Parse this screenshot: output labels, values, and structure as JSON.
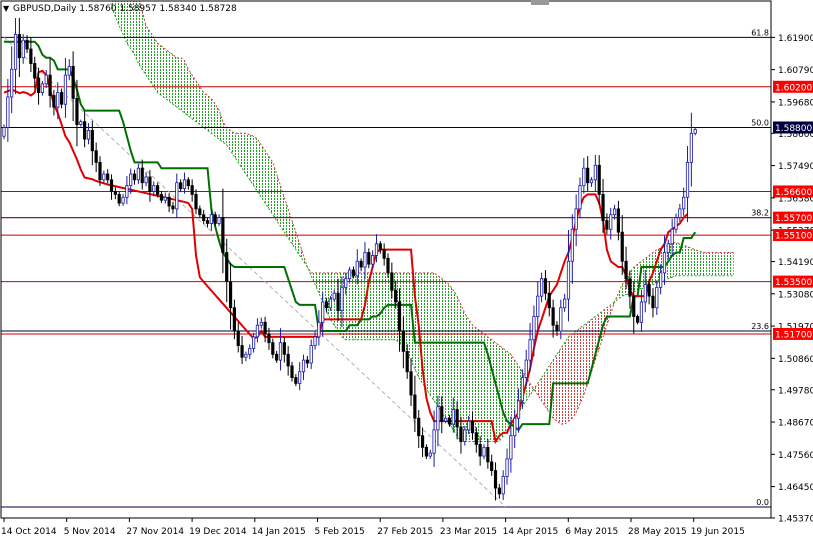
{
  "header": {
    "arrow": "▼",
    "symbol_line": "GBPUSD,Daily  1.58760 1.58957 1.58340 1.58728"
  },
  "colors": {
    "background": "#ffffff",
    "frame": "#000000",
    "bull": "#1a1aa8",
    "bear": "#000000",
    "tenkan": "#e00000",
    "kijun": "#007000",
    "cloud_bear": "#d04040",
    "cloud_bull": "#20a020",
    "level_red": "#cc0000",
    "level_navy": "#000040",
    "label_red_bg": "#ff0000",
    "label_navy_bg": "#000040",
    "label_text": "#ffffff"
  },
  "chart_data": {
    "type": "candlestick",
    "ylim": [
      1.4537,
      1.6315
    ],
    "y_ticks": [
      1.619,
      1.6079,
      1.5968,
      1.586,
      1.5749,
      1.5638,
      1.5527,
      1.5419,
      1.5308,
      1.5197,
      1.5086,
      1.4978,
      1.4867,
      1.4756,
      1.4645,
      1.4537
    ],
    "y_tick_labels": [
      "1.61900",
      "1.60790",
      "1.59680",
      "1.58600",
      "1.57490",
      "1.56380",
      "1.55270",
      "1.54190",
      "1.53080",
      "1.51970",
      "1.50860",
      "1.49780",
      "1.48670",
      "1.47560",
      "1.46450",
      "1.45370"
    ],
    "x_labels": [
      "14 Oct 2014",
      "5 Nov 2014",
      "27 Nov 2014",
      "19 Dec 2014",
      "14 Jan 2015",
      "5 Feb 2015",
      "27 Feb 2015",
      "23 Mar 2015",
      "14 Apr 2015",
      "6 May 2015",
      "28 May 2015",
      "19 Jun 2015"
    ],
    "levels": [
      {
        "value": 1.602,
        "label": "1.60200",
        "kind": "red"
      },
      {
        "value": 1.588,
        "label": "1.58800",
        "kind": "navy"
      },
      {
        "value": 1.566,
        "label": "1.56600",
        "kind": "red"
      },
      {
        "value": 1.557,
        "label": "1.55700",
        "kind": "red"
      },
      {
        "value": 1.551,
        "label": "1.55100",
        "kind": "red"
      },
      {
        "value": 1.535,
        "label": "1.53500",
        "kind": "red"
      },
      {
        "value": 1.517,
        "label": "1.51700",
        "kind": "red"
      }
    ],
    "fib_levels": [
      {
        "value": 1.619,
        "label": "61.8"
      },
      {
        "value": 1.588,
        "label": "50.0"
      },
      {
        "value": 1.557,
        "label": "38.2"
      },
      {
        "value": 1.518,
        "label": "23.6"
      },
      {
        "value": 1.4575,
        "label": "0.0"
      }
    ],
    "trendline": {
      "from": [
        "14 Oct 2014",
        1.619
      ],
      "to": [
        "14 Apr 2015",
        1.4575
      ]
    },
    "series": {
      "close": [
        1.588,
        1.5985,
        1.608,
        1.62,
        1.612,
        1.618,
        1.615,
        1.61,
        1.605,
        1.6,
        1.603,
        1.606,
        1.599,
        1.595,
        1.6,
        1.596,
        1.606,
        1.609,
        1.598,
        1.589,
        1.59,
        1.584,
        1.587,
        1.58,
        1.576,
        1.57,
        1.572,
        1.57,
        1.566,
        1.565,
        1.562,
        1.564,
        1.568,
        1.572,
        1.57,
        1.574,
        1.569,
        1.571,
        1.566,
        1.568,
        1.565,
        1.563,
        1.564,
        1.561,
        1.56,
        1.569,
        1.567,
        1.57,
        1.568,
        1.565,
        1.56,
        1.558,
        1.556,
        1.555,
        1.558,
        1.555,
        1.557,
        1.545,
        1.535,
        1.526,
        1.518,
        1.513,
        1.509,
        1.51,
        1.512,
        1.516,
        1.52,
        1.521,
        1.517,
        1.514,
        1.51,
        1.508,
        1.514,
        1.51,
        1.506,
        1.502,
        1.5,
        1.504,
        1.508,
        1.507,
        1.513,
        1.516,
        1.521,
        1.528,
        1.526,
        1.529,
        1.531,
        1.525,
        1.533,
        1.536,
        1.539,
        1.537,
        1.542,
        1.54,
        1.545,
        1.541,
        1.544,
        1.548,
        1.546,
        1.543,
        1.538,
        1.532,
        1.528,
        1.518,
        1.511,
        1.504,
        1.496,
        1.488,
        1.482,
        1.478,
        1.475,
        1.476,
        1.484,
        1.492,
        1.487,
        1.488,
        1.486,
        1.491,
        1.485,
        1.48,
        1.484,
        1.487,
        1.483,
        1.479,
        1.475,
        1.478,
        1.473,
        1.47,
        1.464,
        1.462,
        1.468,
        1.474,
        1.482,
        1.488,
        1.494,
        1.502,
        1.508,
        1.515,
        1.523,
        1.53,
        1.536,
        1.531,
        1.526,
        1.52,
        1.518,
        1.526,
        1.529,
        1.542,
        1.553,
        1.56,
        1.568,
        1.574,
        1.569,
        1.57,
        1.575,
        1.565,
        1.556,
        1.553,
        1.558,
        1.56,
        1.552,
        1.542,
        1.536,
        1.53,
        1.523,
        1.521,
        1.528,
        1.534,
        1.53,
        1.526,
        1.533,
        1.538,
        1.545,
        1.548,
        1.553,
        1.557,
        1.56,
        1.564,
        1.576,
        1.586,
        1.5873
      ],
      "tenkan": [
        1.6,
        1.6005,
        1.601,
        1.6005,
        1.5998,
        1.6002,
        1.5998,
        1.599,
        1.6,
        1.607,
        1.6075,
        1.606,
        1.601,
        1.596,
        1.593,
        1.589,
        1.585,
        1.583,
        1.58,
        1.577,
        1.5735,
        1.5708,
        1.5705,
        1.5702,
        1.5696,
        1.5692,
        1.5688,
        1.5684,
        1.5681,
        1.5678,
        1.5675,
        1.5672,
        1.5669,
        1.5666,
        1.5663,
        1.566,
        1.5657,
        1.5654,
        1.5651,
        1.5648,
        1.5645,
        1.5642,
        1.5639,
        1.5636,
        1.5633,
        1.563,
        1.5627,
        1.5624,
        1.562,
        1.56,
        1.544,
        1.5365,
        1.5349,
        1.5334,
        1.5319,
        1.5304,
        1.5289,
        1.5274,
        1.5259,
        1.5244,
        1.5229,
        1.5214,
        1.5199,
        1.5184,
        1.5169,
        1.5154,
        1.516,
        1.518,
        1.516,
        1.516,
        1.516,
        1.516,
        1.516,
        1.516,
        1.516,
        1.516,
        1.516,
        1.516,
        1.516,
        1.516,
        1.516,
        1.516,
        1.516,
        1.522,
        1.522,
        1.522,
        1.522,
        1.522,
        1.522,
        1.522,
        1.522,
        1.522,
        1.522,
        1.522,
        1.527,
        1.535,
        1.54,
        1.545,
        1.546,
        1.546,
        1.546,
        1.546,
        1.546,
        1.546,
        1.546,
        1.546,
        1.546,
        1.53,
        1.52,
        1.505,
        1.495,
        1.49,
        1.487,
        1.487,
        1.487,
        1.487,
        1.487,
        1.487,
        1.487,
        1.487,
        1.487,
        1.487,
        1.487,
        1.487,
        1.487,
        1.487,
        1.487,
        1.487,
        1.48,
        1.482,
        1.483,
        1.483,
        1.486,
        1.488,
        1.49,
        1.495,
        1.5,
        1.505,
        1.512,
        1.518,
        1.522,
        1.526,
        1.53,
        1.532,
        1.534,
        1.538,
        1.542,
        1.545,
        1.55,
        1.556,
        1.561,
        1.564,
        1.565,
        1.565,
        1.565,
        1.562,
        1.556,
        1.546,
        1.542,
        1.541,
        1.54,
        1.54,
        1.537,
        1.532,
        1.53,
        1.53,
        1.53,
        1.53,
        1.535,
        1.538,
        1.542,
        1.546,
        1.548,
        1.552,
        1.553,
        1.554,
        1.555,
        1.557,
        1.5582
      ],
      "kijun": [
        1.6175,
        1.6175,
        1.6175,
        1.6175,
        1.6175,
        1.6175,
        1.6175,
        1.6175,
        1.6175,
        1.616,
        1.613,
        1.612,
        1.612,
        1.611,
        1.608,
        1.608,
        1.608,
        1.608,
        1.605,
        1.601,
        1.596,
        1.5938,
        1.5938,
        1.5938,
        1.5938,
        1.5938,
        1.5938,
        1.5938,
        1.5938,
        1.5938,
        1.5938,
        1.59,
        1.585,
        1.58,
        1.576,
        1.576,
        1.576,
        1.576,
        1.576,
        1.576,
        1.576,
        1.574,
        1.574,
        1.574,
        1.574,
        1.574,
        1.574,
        1.574,
        1.574,
        1.574,
        1.574,
        1.574,
        1.574,
        1.574,
        1.56,
        1.554,
        1.549,
        1.545,
        1.543,
        1.541,
        1.54,
        1.54,
        1.54,
        1.54,
        1.54,
        1.54,
        1.54,
        1.54,
        1.54,
        1.54,
        1.54,
        1.54,
        1.54,
        1.54,
        1.536,
        1.532,
        1.528,
        1.527,
        1.527,
        1.527,
        1.527,
        1.527,
        1.518,
        1.518,
        1.518,
        1.518,
        1.518,
        1.518,
        1.518,
        1.518,
        1.52,
        1.52,
        1.52,
        1.522,
        1.522,
        1.522,
        1.523,
        1.523,
        1.524,
        1.526,
        1.527,
        1.527,
        1.527,
        1.527,
        1.527,
        1.527,
        1.527,
        1.514,
        1.514,
        1.514,
        1.514,
        1.514,
        1.514,
        1.514,
        1.514,
        1.514,
        1.514,
        1.514,
        1.514,
        1.514,
        1.514,
        1.514,
        1.514,
        1.514,
        1.514,
        1.514,
        1.51,
        1.505,
        1.5,
        1.495,
        1.49,
        1.487,
        1.486,
        1.485,
        1.484,
        1.486,
        1.486,
        1.486,
        1.486,
        1.486,
        1.486,
        1.486,
        1.486,
        1.5,
        1.5,
        1.5,
        1.5,
        1.5,
        1.5,
        1.5,
        1.5,
        1.5,
        1.5,
        1.505,
        1.51,
        1.515,
        1.52,
        1.523,
        1.523,
        1.523,
        1.523,
        1.523,
        1.523,
        1.523,
        1.53,
        1.53,
        1.54,
        1.54,
        1.54,
        1.54,
        1.54,
        1.54,
        1.54,
        1.542,
        1.544,
        1.545,
        1.545,
        1.55,
        1.55,
        1.55,
        1.552
      ],
      "senkou_a": [
        1.68,
        1.675,
        1.67,
        1.665,
        1.66,
        1.655,
        1.65,
        1.645,
        1.64,
        1.634,
        1.628,
        1.623,
        1.621,
        1.619,
        1.617,
        1.616,
        1.615,
        1.614,
        1.613,
        1.612,
        1.612,
        1.611,
        1.608,
        1.606,
        1.604,
        1.602,
        1.6,
        1.599,
        1.598,
        1.596,
        1.594,
        1.59,
        1.588,
        1.587,
        1.586,
        1.586,
        1.586,
        1.586,
        1.5855,
        1.585,
        1.584,
        1.582,
        1.58,
        1.578,
        1.576,
        1.572,
        1.568,
        1.564,
        1.56,
        1.556,
        1.552,
        1.548,
        1.544,
        1.54,
        1.538,
        1.538,
        1.538,
        1.538,
        1.538,
        1.538,
        1.538,
        1.538,
        1.538,
        1.538,
        1.538,
        1.538,
        1.538,
        1.538,
        1.538,
        1.538,
        1.538,
        1.538,
        1.538,
        1.538,
        1.538,
        1.538,
        1.538,
        1.538,
        1.538,
        1.538,
        1.538,
        1.538,
        1.538,
        1.538,
        1.538,
        1.538,
        1.538,
        1.537,
        1.536,
        1.535,
        1.534,
        1.532,
        1.53,
        1.527,
        1.524,
        1.522,
        1.52,
        1.519,
        1.518,
        1.517,
        1.516,
        1.515,
        1.514,
        1.513,
        1.512,
        1.511,
        1.51,
        1.508,
        1.506,
        1.504,
        1.502,
        1.5,
        1.498,
        1.496,
        1.494,
        1.492,
        1.49,
        1.488,
        1.487,
        1.486,
        1.486,
        1.487,
        1.488,
        1.49,
        1.493,
        1.496,
        1.5,
        1.504,
        1.508,
        1.512,
        1.516,
        1.52,
        1.524,
        1.528,
        1.531,
        1.534,
        1.536,
        1.538,
        1.54,
        1.541,
        1.542,
        1.543,
        1.544,
        1.545,
        1.546,
        1.5465,
        1.547,
        1.5475,
        1.548,
        1.5485,
        1.548,
        1.5475,
        1.547,
        1.5465,
        1.546,
        1.5455,
        1.545,
        1.545,
        1.545,
        1.545,
        1.545,
        1.545,
        1.545,
        1.545,
        1.545
      ],
      "senkou_b": [
        1.64,
        1.635,
        1.63,
        1.626,
        1.623,
        1.62,
        1.617,
        1.615,
        1.613,
        1.61,
        1.608,
        1.606,
        1.604,
        1.602,
        1.6,
        1.599,
        1.598,
        1.597,
        1.596,
        1.595,
        1.594,
        1.593,
        1.592,
        1.591,
        1.59,
        1.589,
        1.588,
        1.587,
        1.586,
        1.585,
        1.584,
        1.583,
        1.582,
        1.58,
        1.578,
        1.576,
        1.574,
        1.572,
        1.57,
        1.568,
        1.566,
        1.564,
        1.562,
        1.56,
        1.558,
        1.556,
        1.554,
        1.552,
        1.55,
        1.548,
        1.546,
        1.544,
        1.542,
        1.54,
        1.537,
        1.534,
        1.531,
        1.528,
        1.525,
        1.522,
        1.52,
        1.518,
        1.516,
        1.515,
        1.515,
        1.515,
        1.515,
        1.515,
        1.515,
        1.515,
        1.515,
        1.515,
        1.515,
        1.515,
        1.515,
        1.515,
        1.515,
        1.514,
        1.512,
        1.51,
        1.508,
        1.505,
        1.502,
        1.5,
        1.498,
        1.496,
        1.494,
        1.492,
        1.49,
        1.488,
        1.486,
        1.484,
        1.482,
        1.48,
        1.48,
        1.48,
        1.48,
        1.48,
        1.48,
        1.48,
        1.48,
        1.48,
        1.48,
        1.48,
        1.482,
        1.484,
        1.486,
        1.488,
        1.49,
        1.492,
        1.494,
        1.496,
        1.498,
        1.5,
        1.502,
        1.504,
        1.506,
        1.508,
        1.51,
        1.512,
        1.514,
        1.516,
        1.517,
        1.518,
        1.519,
        1.52,
        1.521,
        1.522,
        1.523,
        1.524,
        1.525,
        1.526,
        1.527,
        1.528,
        1.529,
        1.53,
        1.5305,
        1.531,
        1.5315,
        1.532,
        1.5325,
        1.533,
        1.5335,
        1.534,
        1.5345,
        1.535,
        1.5355,
        1.536,
        1.5365,
        1.537,
        1.537,
        1.537,
        1.537,
        1.537,
        1.537,
        1.537,
        1.537,
        1.537,
        1.537,
        1.537,
        1.537,
        1.537,
        1.537,
        1.537,
        1.537
      ]
    }
  }
}
